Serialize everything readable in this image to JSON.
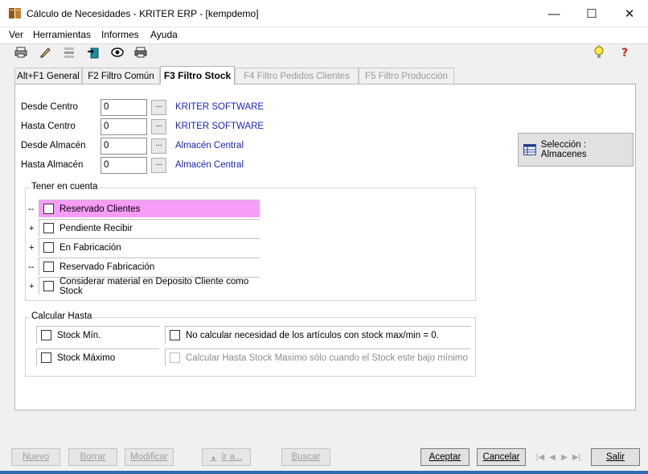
{
  "window": {
    "title": "Cálculo de Necesidades - KRITER ERP - [kempdemo]"
  },
  "window_controls": {
    "minimize": "—",
    "maximize": "☐",
    "close": "✕"
  },
  "menu": [
    "Ver",
    "Herramientas",
    "Informes",
    "Ayuda"
  ],
  "toolbar": {
    "icons": [
      "printer-icon",
      "pencil-icon",
      "layers-icon",
      "export-icon",
      "preview-eye-icon",
      "printer-setup-icon"
    ],
    "right_icons": [
      "lightbulb-icon",
      "help-icon"
    ]
  },
  "tabs": [
    {
      "label": "Alt+F1 General",
      "state": "normal"
    },
    {
      "label": "F2 Filtro Común",
      "state": "normal"
    },
    {
      "label": "F3 Filtro Stock",
      "state": "active"
    },
    {
      "label": "F4 Filtro Pedidos Clientes",
      "state": "disabled"
    },
    {
      "label": "F5 Filtro Producción",
      "state": "disabled"
    }
  ],
  "filters": [
    {
      "label": "Desde Centro",
      "value": "0",
      "button": "...",
      "description": "KRITER SOFTWARE"
    },
    {
      "label": "Hasta Centro",
      "value": "0",
      "button": "...",
      "description": "KRITER SOFTWARE"
    },
    {
      "label": "Desde Almacén",
      "value": "0",
      "button": "...",
      "description": "Almacén Central"
    },
    {
      "label": "Hasta Almacén",
      "value": "0",
      "button": "...",
      "description": "Almacén Central"
    }
  ],
  "selection_button": {
    "label": "Selección : Almacenes",
    "icon": "table-icon"
  },
  "tener_en_cuenta": {
    "title": "Tener en cuenta",
    "items": [
      {
        "sign": "--",
        "label": "Reservado Clientes",
        "checked": false,
        "highlight": "#f79cf7"
      },
      {
        "sign": "+",
        "label": "Pendiente Recibir",
        "checked": false
      },
      {
        "sign": "+",
        "label": "En Fabricación",
        "checked": false
      },
      {
        "sign": "--",
        "label": "Reservado Fabricación",
        "checked": false
      },
      {
        "sign": "+",
        "label": "Considerar material en Deposito Cliente como Stock",
        "checked": false
      }
    ]
  },
  "calcular_hasta": {
    "title": "Calcular Hasta",
    "stock_min": "Stock Mín.",
    "stock_max": "Stock Máximo",
    "no_calcular": "No calcular necesidad de los artículos con stock max/min = 0.",
    "calcular_hasta_max": "Calcular Hasta Stock Maximo sólo cuando el Stock este bajo mínimo"
  },
  "bottom_buttons": {
    "nuevo": "Nuevo",
    "borrar": "Borrar",
    "modificar": "Modificar",
    "ir_a": "Ir a...",
    "buscar": "Buscar",
    "aceptar": "Aceptar",
    "cancelar": "Cancelar",
    "salir": "Salir"
  },
  "nav_glyphs": [
    "|◀",
    "◀",
    "▶",
    "▶|"
  ]
}
